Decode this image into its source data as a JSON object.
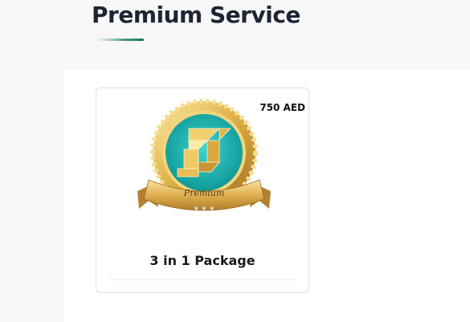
{
  "section": {
    "title": "Premium Service"
  },
  "cards": [
    {
      "price": "750 AED",
      "title": "3 in 1 Package",
      "badge_icon": "premium-medal-icon",
      "badge_text": "Premium"
    }
  ],
  "colors": {
    "title_text": "#1d2433",
    "accent_green": "#1e6f5c",
    "badge_teal": "#14b3b0",
    "badge_gold": "#e0b44a"
  }
}
